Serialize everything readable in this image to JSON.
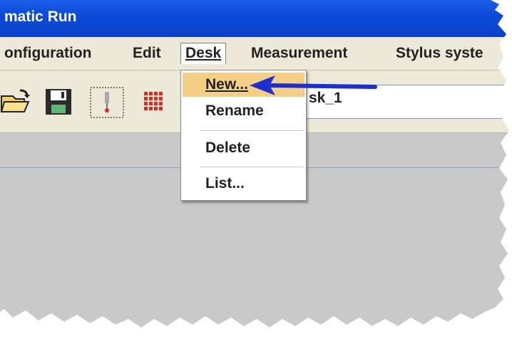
{
  "window": {
    "title": "matic Run"
  },
  "menubar": {
    "items": [
      {
        "label": "onfiguration",
        "mnemonic": ""
      },
      {
        "label": "Edit",
        "mnemonic": ""
      },
      {
        "label": "Desk",
        "mnemonic": "D",
        "open": true
      },
      {
        "label": "Measurement",
        "mnemonic": "M"
      },
      {
        "label": "Stylus syste",
        "mnemonic": "S"
      }
    ]
  },
  "toolbar": {
    "buttons": [
      "open-folder-icon",
      "save-floppy-icon",
      "stylus-probe-icon",
      "grid-dots-icon"
    ],
    "desk_field_value": "sk_1"
  },
  "dropdown": {
    "items": [
      {
        "label": "New...",
        "mnemonic": "N",
        "highlighted": true
      },
      {
        "label": "Rename",
        "mnemonic": "R"
      },
      {
        "label": "Delete",
        "mnemonic": "D"
      },
      {
        "label": "List...",
        "mnemonic": "L"
      }
    ]
  },
  "annotation": {
    "type": "arrow",
    "points_to": "New...",
    "color": "#1d2fd1"
  },
  "colors": {
    "titlebar": "#0b49d6",
    "menubar": "#ece9d8",
    "highlight": "#f4cf86",
    "workspace": "#c9c9c9"
  }
}
